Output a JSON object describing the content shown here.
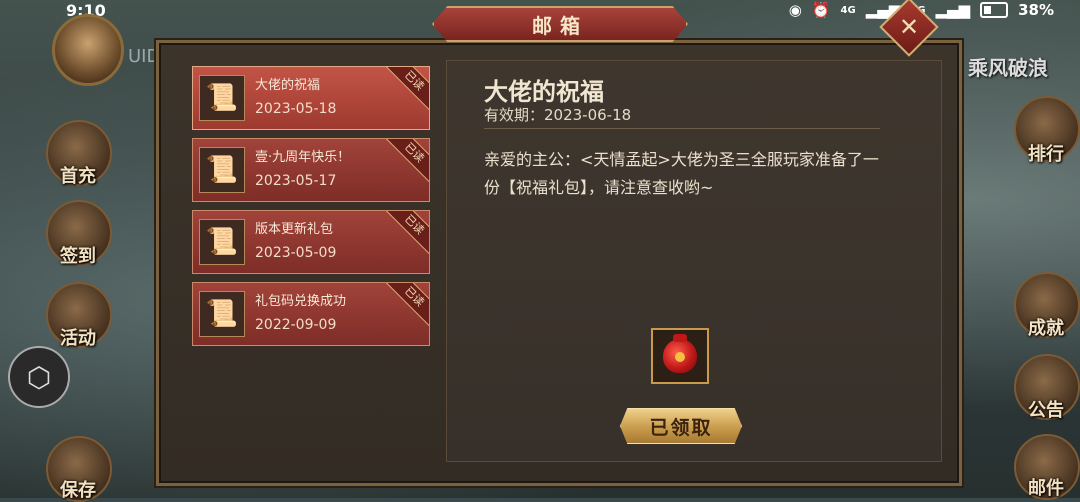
{
  "status_bar": {
    "time": "9:10",
    "battery": "38%",
    "signal_a": "4G",
    "signal_b": "4G"
  },
  "player": {
    "uid_label": "UID"
  },
  "background": {
    "right_title": "乘风破浪",
    "left_buttons": [
      "首充",
      "签到",
      "活动",
      "保存"
    ],
    "right_buttons": [
      "排行",
      "成就",
      "公告",
      "邮件"
    ]
  },
  "mailbox": {
    "title": "邮箱",
    "close_symbol": "✕",
    "mails": [
      {
        "subject": "大佬的祝福",
        "date": "2023-05-18",
        "tag": "已读",
        "active": true
      },
      {
        "subject": "壹·九周年快乐！",
        "date": "2023-05-17",
        "tag": "已读",
        "active": false
      },
      {
        "subject": "版本更新礼包",
        "date": "2023-05-09",
        "tag": "已读",
        "active": false
      },
      {
        "subject": "礼包码兑换成功",
        "date": "2022-09-09",
        "tag": "已读",
        "active": false
      }
    ],
    "detail": {
      "title": "大佬的祝福",
      "validity": "有效期：2023-06-18",
      "body": "亲爱的主公：<天情孟起>大佬为圣三全服玩家准备了一份【祝福礼包】，请注意查收哟~",
      "reward_icon": "red-lucky-bag-icon",
      "claim_label": "已领取"
    }
  },
  "colors": {
    "accent_red": "#a1433a",
    "gold": "#c99b4b",
    "panel": "#3c342b"
  }
}
